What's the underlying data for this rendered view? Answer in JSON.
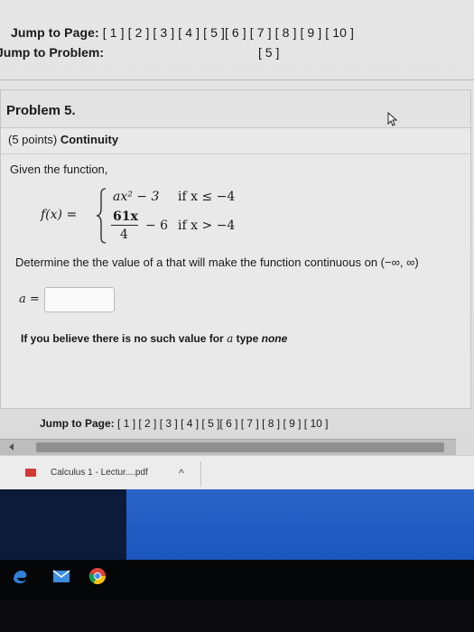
{
  "navigation": {
    "jump_to_page_label": "Jump to Page:",
    "page_links": "[ 1 ] [ 2 ] [ 3 ] [ 4 ] [ 5 ][ 6 ] [ 7 ] [ 8 ] [ 9 ] [ 10 ]",
    "jump_to_problem_label": "Jump to Problem:",
    "problem_link": "[ 5 ]"
  },
  "problem": {
    "title": "Problem 5.",
    "points": "(5 points)",
    "topic": "Continuity",
    "given": "Given the function,",
    "function_name": "f(x) =",
    "case1_expr": "ax² − 3",
    "case1_cond": "if x ≤ −4",
    "case2_num": "61x",
    "case2_den": "4",
    "case2_rest": "− 6",
    "case2_cond": "if x > −4",
    "determine_text": "Determine the the value of a that will make the function continuous on (−∞, ∞)",
    "answer_label": "a =",
    "answer_value": "",
    "note_prefix": "If you believe there is no such value for",
    "note_var": "a",
    "note_mid": "type",
    "note_none": "none"
  },
  "footer": {
    "jump_to_page_label": "Jump to Page:",
    "page_links": "[ 1 ] [ 2 ] [ 3 ] [ 4 ] [ 5 ][ 6 ] [ 7 ] [ 8 ] [ 9 ] [ 10 ]"
  },
  "download_bar": {
    "file_name": "Calculus 1 - Lectur....pdf",
    "chevron": "^"
  },
  "icons": {
    "cursor": "mouse-pointer-icon",
    "pdf": "pdf-file-icon",
    "taskbar": [
      "edge-icon",
      "mail-icon",
      "chrome-icon"
    ]
  },
  "colors": {
    "pdf_red": "#d23a36",
    "desktop_blue": "#1f5ec6",
    "taskbar": "#050608"
  }
}
